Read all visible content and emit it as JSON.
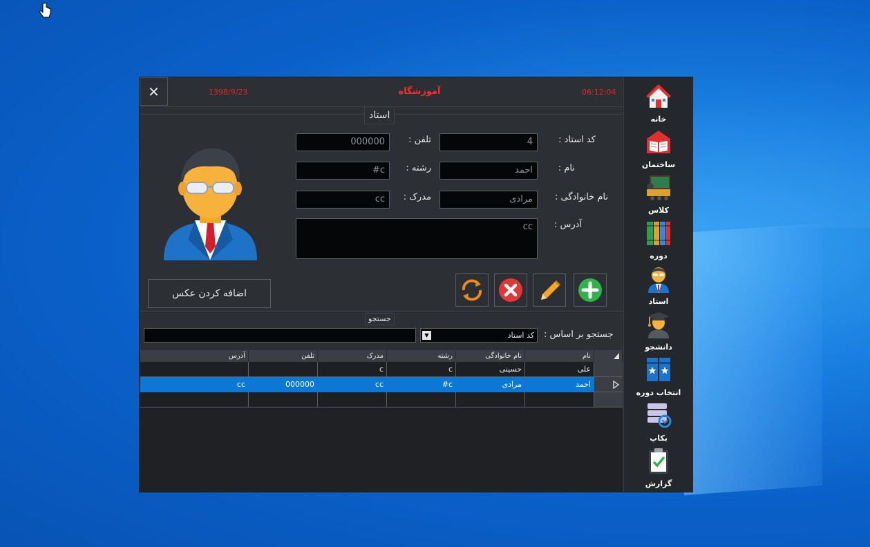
{
  "window": {
    "close_label": "✕",
    "date": "1398/9/23",
    "title": "آموزشگاه",
    "time": "06:12:04"
  },
  "form": {
    "group_title": "استاد",
    "fields": {
      "teacher_code": {
        "label": "کد استاد  :",
        "value": "4"
      },
      "phone": {
        "label": "تلفن  :",
        "value": "000000"
      },
      "first_name": {
        "label": "نام  :",
        "value": "احمد"
      },
      "major": {
        "label": "رشته  :",
        "value": "#c"
      },
      "last_name": {
        "label": "نام خانوادگی  :",
        "value": "مرادی"
      },
      "degree": {
        "label": "مدرک  :",
        "value": "cc"
      },
      "address": {
        "label": "آدرس  :",
        "value": "cc"
      }
    },
    "add_photo_label": "اضافه کردن عکس"
  },
  "search": {
    "group_title": "جستجو",
    "by_label": "جستجو بر اساس :",
    "by_selected": "کد استاد",
    "query": ""
  },
  "grid": {
    "columns": [
      "نام",
      "نام خانوادگی",
      "رشته",
      "مدرک",
      "تلفن",
      "آدرس"
    ],
    "rows": [
      [
        "علی",
        "حسینی",
        "c",
        "c",
        "",
        ""
      ],
      [
        "احمد",
        "مرادی",
        "#c",
        "cc",
        "000000",
        "cc"
      ],
      [
        "",
        "",
        "",
        "",
        "",
        ""
      ]
    ],
    "selected_row": 1
  },
  "sidebar": {
    "items": [
      {
        "label": "خانه",
        "icon": "home-icon"
      },
      {
        "label": "ساختمان",
        "icon": "building-icon"
      },
      {
        "label": "کلاس",
        "icon": "classroom-icon"
      },
      {
        "label": "دوره",
        "icon": "books-icon"
      },
      {
        "label": "استاد",
        "icon": "teacher-icon"
      },
      {
        "label": "دانشجو",
        "icon": "student-icon"
      },
      {
        "label": "انتخاب دوره",
        "icon": "course-select-icon"
      },
      {
        "label": "بکاپ",
        "icon": "backup-icon"
      },
      {
        "label": "گزارش",
        "icon": "report-icon"
      }
    ]
  },
  "colors": {
    "accent": "#0a78d4",
    "title_red": "#ff2a2a",
    "panel": "#2c2f34"
  }
}
